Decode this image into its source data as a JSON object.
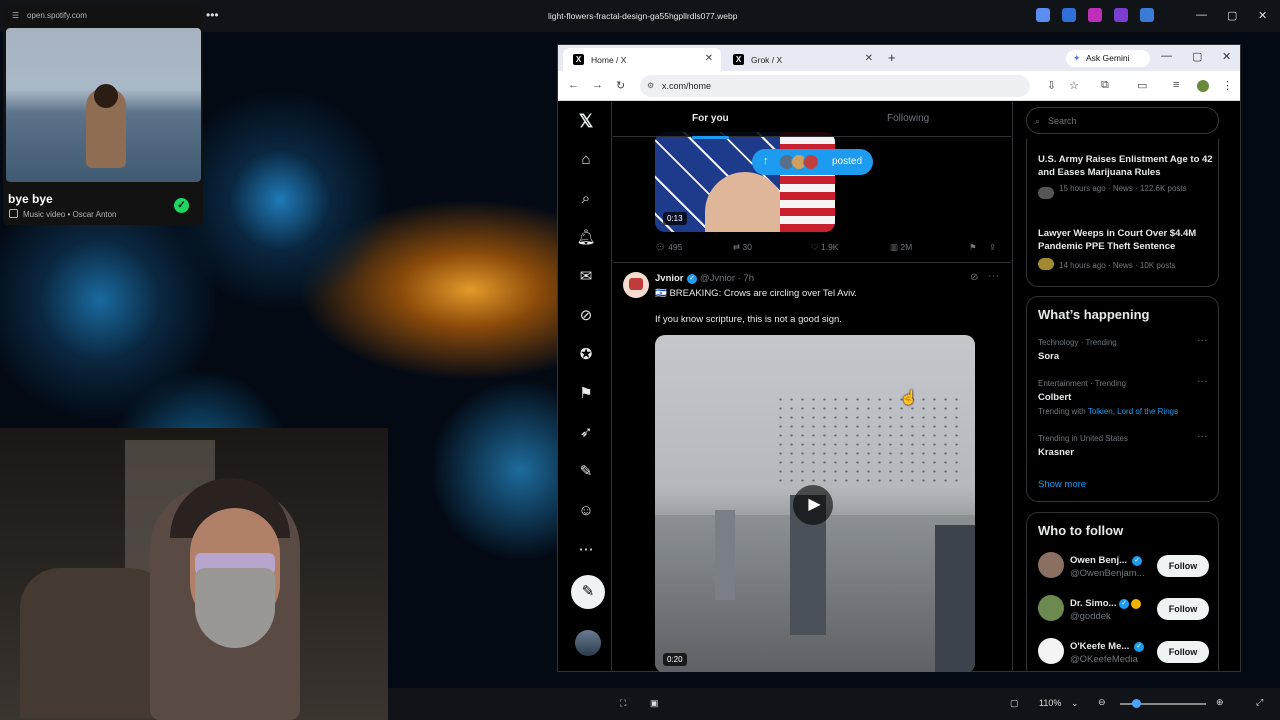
{
  "viewer": {
    "title": "light-flowers-fractal-design-ga55hgpllrdls077.webp",
    "zoom": "110%",
    "bottom_icons": [
      "fit-icon",
      "crop-icon",
      "zoom-out-icon",
      "zoom-in-icon",
      "fullscreen-icon"
    ]
  },
  "spotify": {
    "url": "open.spotify.com",
    "title": "bye bye",
    "subtitle": "Music video • Oscar Anton"
  },
  "browser": {
    "tabs": [
      {
        "label": "Home / X",
        "active": true
      },
      {
        "label": "Grok / X",
        "active": false
      }
    ],
    "ask_gemini": "Ask Gemini",
    "url": "x.com/home"
  },
  "x": {
    "tabs": {
      "for_you": "For you",
      "following": "Following"
    },
    "new_posts_pill": "posted",
    "prev_post": {
      "duration": "0:13",
      "replies": "495",
      "reposts": "30",
      "likes": "1.9K",
      "views": "2M"
    },
    "post": {
      "name": "Jvnior",
      "handle": "@Jvnior · 7h",
      "text1": "🇮🇱 BREAKING: Crows are circling over Tel Aviv.",
      "text2": "If you know scripture, this is not a good sign.",
      "duration": "0:20"
    },
    "search_placeholder": "Search",
    "news": [
      {
        "title": "U.S. Army Raises Enlistment Age to 42 and Eases Marijuana Rules",
        "meta": "15 hours ago · News · 122.6K posts"
      },
      {
        "title": "Lawyer Weeps in Court Over $4.4M Pandemic PPE Theft Sentence",
        "meta": "14 hours ago · News · 10K posts"
      }
    ],
    "whats_happening": {
      "heading": "What’s happening",
      "trends": [
        {
          "context": "Technology · Trending",
          "name": "Sora",
          "with": ""
        },
        {
          "context": "Entertainment · Trending",
          "name": "Colbert",
          "with_prefix": "Trending with",
          "with": "Tolkien, Lord of the Rings"
        },
        {
          "context": "Trending in United States",
          "name": "Krasner",
          "with": ""
        }
      ],
      "show_more": "Show more"
    },
    "who_to_follow": {
      "heading": "Who to follow",
      "users": [
        {
          "name": "Owen Benj...",
          "handle": "@OwenBenjam...",
          "button": "Follow"
        },
        {
          "name": "Dr. Simo...",
          "handle": "@goddek",
          "button": "Follow"
        },
        {
          "name": "O'Keefe Me...",
          "handle": "@OKeefeMedia",
          "button": "Follow"
        }
      ]
    }
  }
}
